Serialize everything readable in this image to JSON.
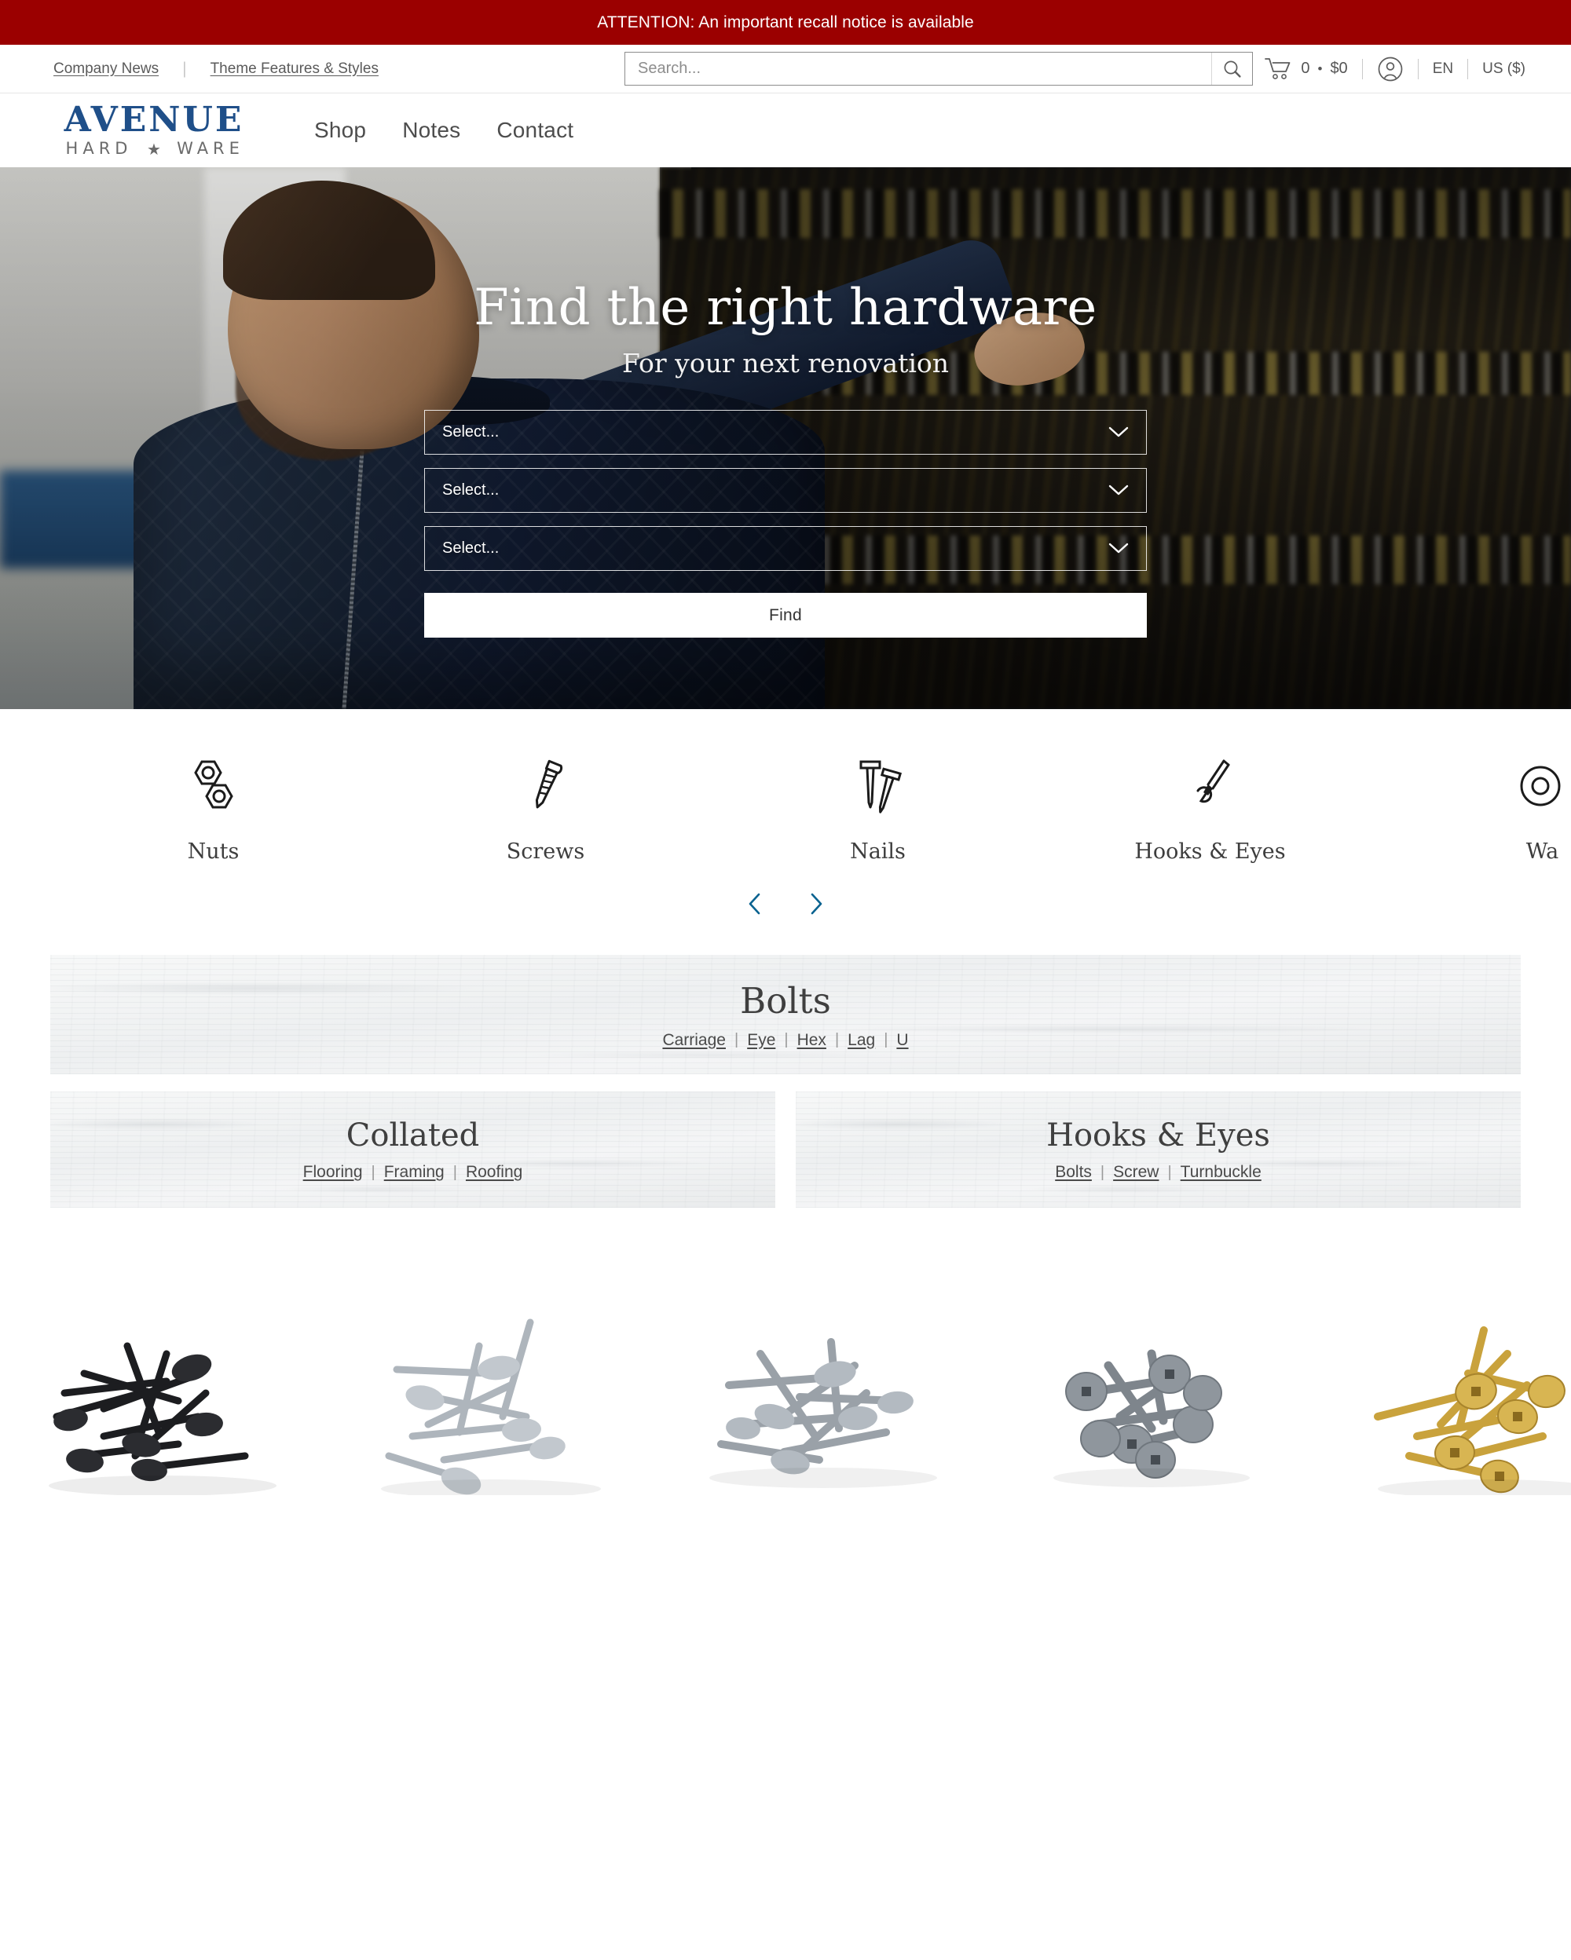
{
  "announcement": {
    "text": "ATTENTION: An important recall notice is available",
    "background": "#9b0000",
    "color": "#ffffff"
  },
  "utility_bar": {
    "links": [
      {
        "label": "Company News"
      },
      {
        "label": "Theme Features & Styles"
      }
    ],
    "separator": "|",
    "search": {
      "placeholder": "Search...",
      "value": "",
      "icon": "search-icon"
    },
    "cart": {
      "icon": "shopping-cart-icon",
      "count": "0",
      "dot": "•",
      "total": "$0"
    },
    "account": {
      "icon": "user-account-icon"
    },
    "language": "EN",
    "currency": "US ($)"
  },
  "header": {
    "logo": {
      "line1": "AVENUE",
      "line2_left": "HARD",
      "line2_star": "★",
      "line2_right": "WARE",
      "color_primary": "#1f4f89",
      "color_secondary": "#6b6b6b"
    },
    "nav": [
      {
        "label": "Shop"
      },
      {
        "label": "Notes"
      },
      {
        "label": "Contact"
      }
    ]
  },
  "hero": {
    "title": "Find the right hardware",
    "subtitle": "For your next renovation",
    "selects": [
      {
        "value": "Select...",
        "icon": "chevron-down-icon"
      },
      {
        "value": "Select...",
        "icon": "chevron-down-icon"
      },
      {
        "value": "Select...",
        "icon": "chevron-down-icon"
      }
    ],
    "submit_label": "Find",
    "image_alt": "Man browsing tools on a hardware store shelf"
  },
  "categories": {
    "items": [
      {
        "label": "Nuts",
        "icon": "hex-nuts-icon"
      },
      {
        "label": "Screws",
        "icon": "screw-icon"
      },
      {
        "label": "Nails",
        "icon": "nails-icon"
      },
      {
        "label": "Hooks & Eyes",
        "icon": "hook-icon"
      },
      {
        "label": "Wa",
        "icon": "washer-icon"
      }
    ],
    "prev_label": "‹",
    "next_label": "›",
    "arrow_color": "#0a6390"
  },
  "promos": {
    "featured": {
      "title": "Bolts",
      "links": [
        "Carriage",
        "Eye",
        "Hex",
        "Lag",
        "U"
      ],
      "pipe": "|"
    },
    "secondary": [
      {
        "title": "Collated",
        "links": [
          "Flooring",
          "Framing",
          "Roofing"
        ],
        "pipe": "|"
      },
      {
        "title": "Hooks & Eyes",
        "links": [
          "Bolts",
          "Screw",
          "Turnbuckle"
        ],
        "pipe": "|"
      }
    ]
  },
  "product_strip": {
    "items": [
      {
        "name": "black-drywall-screws",
        "color": "#2f3034"
      },
      {
        "name": "zinc-wood-screws",
        "color": "#b6bcc2"
      },
      {
        "name": "silver-coarse-screws",
        "color": "#9aa1a8"
      },
      {
        "name": "stainless-washer-head-screws",
        "color": "#7e858c"
      },
      {
        "name": "brass-yellow-zinc-screws",
        "color": "#c9a23c"
      }
    ]
  }
}
